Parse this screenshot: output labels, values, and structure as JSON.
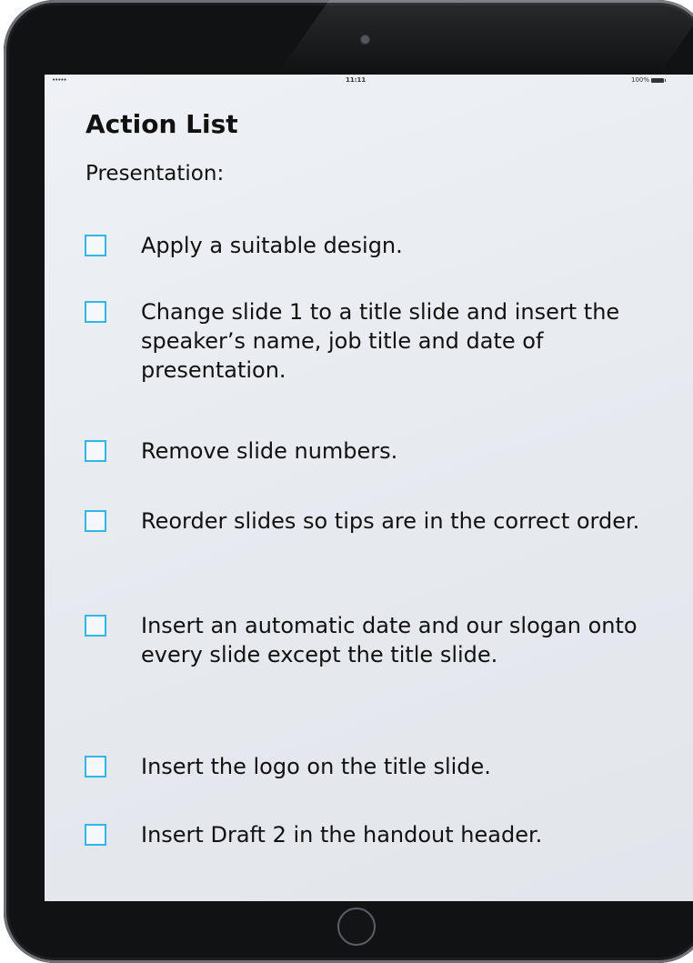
{
  "status_bar": {
    "signal": "•••••",
    "time": "11:11",
    "battery": "100%"
  },
  "title": "Action List",
  "section_label": "Presentation:",
  "items": [
    {
      "text": "Apply a suitable design.",
      "checked": false
    },
    {
      "text": "Change slide 1 to a title slide and insert the speaker’s name, job title and date of presentation.",
      "checked": false
    },
    {
      "text": "Remove slide numbers.",
      "checked": false
    },
    {
      "text": "Reorder slides so tips are in the correct order.",
      "checked": false
    },
    {
      "text": "Insert an automatic date and our slogan onto every slide except the title slide.",
      "checked": false
    },
    {
      "text": "Insert the logo on the title slide.",
      "checked": false
    },
    {
      "text": "Insert Draft 2 in the handout header.",
      "checked": false
    }
  ],
  "colors": {
    "checkbox_border": "#32b6e6",
    "bezel": "#111214",
    "screen_background": "#e9edf1"
  }
}
